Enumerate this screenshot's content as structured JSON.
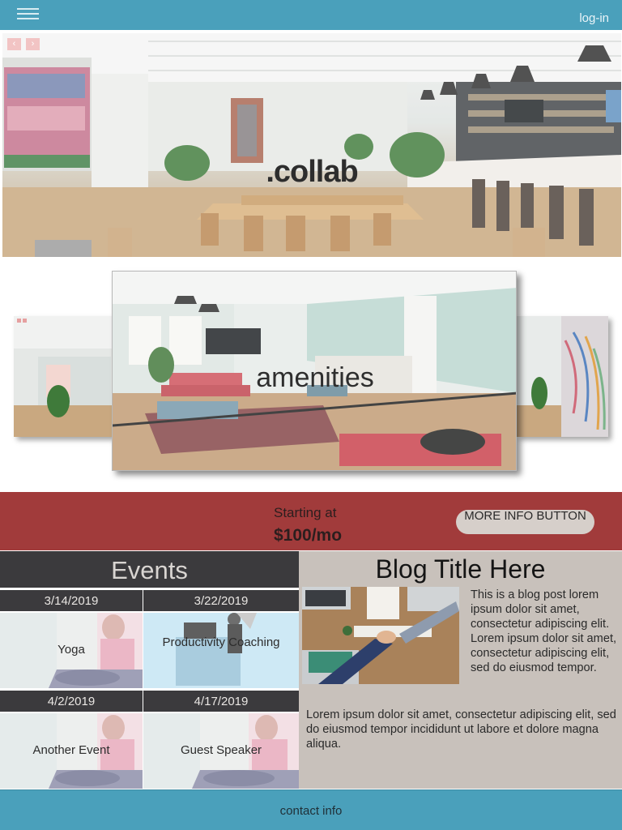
{
  "header": {
    "login_label": "log-in",
    "menu_icon": "hamburger-menu-icon"
  },
  "hero": {
    "title": ".collab",
    "prev_icon": "chevron-left-icon",
    "next_icon": "chevron-right-icon",
    "prev_glyph": "‹",
    "next_glyph": "›"
  },
  "amenities": {
    "title": "amenities"
  },
  "pricing": {
    "label": "Starting at",
    "price": "$100/mo",
    "button_label": "MORE INFO BUTTON"
  },
  "events": {
    "title": "Events",
    "items": [
      {
        "date": "3/14/2019",
        "name": "Yoga"
      },
      {
        "date": "3/22/2019",
        "name": "Productivity Coaching"
      },
      {
        "date": "4/2/2019",
        "name": "Another Event"
      },
      {
        "date": "4/17/2019",
        "name": "Guest Speaker"
      }
    ]
  },
  "blog": {
    "title": "Blog Title Here",
    "paragraph1": "This is a blog post lorem ipsum dolor sit amet, consectetur adipiscing elit. Lorem ipsum dolor sit amet, consectetur adipiscing elit, sed do eiusmod tempor.",
    "paragraph2": "Lorem ipsum dolor sit amet, consectetur adipiscing elit, sed do eiusmod tempor incididunt ut labore et dolore magna aliqua."
  },
  "footer": {
    "label": "contact info"
  },
  "colors": {
    "header": "#4aa0bb",
    "price_band": "#a13b3b",
    "events_dark": "#3b3a3d",
    "blog_bg": "#c8c1bb"
  }
}
